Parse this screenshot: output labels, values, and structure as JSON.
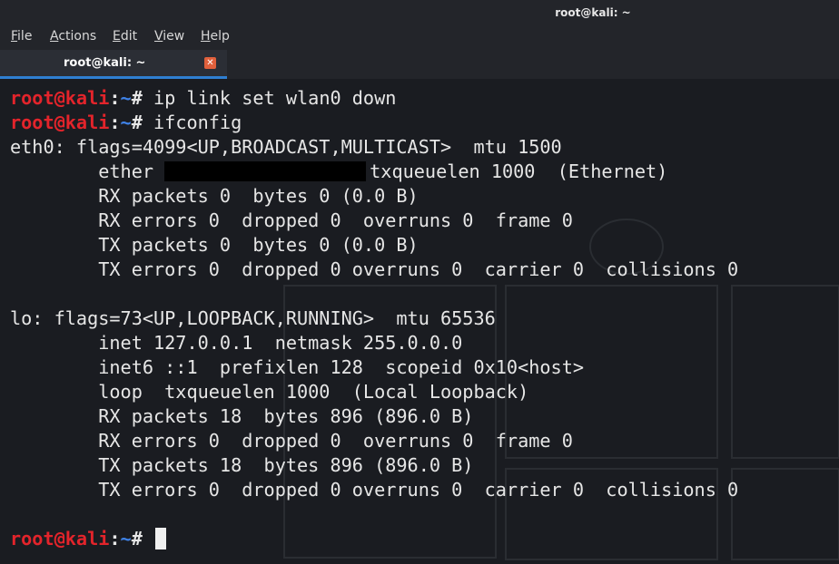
{
  "window": {
    "title": "root@kali: ~"
  },
  "menu": [
    "File",
    "Actions",
    "Edit",
    "View",
    "Help"
  ],
  "tab": {
    "label": "root@kali: ~"
  },
  "prompt": {
    "user": "root@kali",
    "colon": ":",
    "path": "~",
    "symbol": "#"
  },
  "terminal": {
    "cmd1": " ip link set wlan0 down",
    "cmd2": " ifconfig",
    "eth0": {
      "header": "eth0: flags=4099<UP,BROADCAST,MULTICAST>  mtu 1500",
      "ether_prefix": "        ether ",
      "ether_suffix": "txqueuelen 1000  (Ethernet)",
      "rx_packets": "        RX packets 0  bytes 0 (0.0 B)",
      "rx_errors": "        RX errors 0  dropped 0  overruns 0  frame 0",
      "tx_packets": "        TX packets 0  bytes 0 (0.0 B)",
      "tx_errors": "        TX errors 0  dropped 0 overruns 0  carrier 0  collisions 0"
    },
    "lo": {
      "header": "lo: flags=73<UP,LOOPBACK,RUNNING>  mtu 65536",
      "inet": "        inet 127.0.0.1  netmask 255.0.0.0",
      "inet6": "        inet6 ::1  prefixlen 128  scopeid 0x10<host>",
      "loop": "        loop  txqueuelen 1000  (Local Loopback)",
      "rx_packets": "        RX packets 18  bytes 896 (896.0 B)",
      "rx_errors": "        RX errors 0  dropped 0  overruns 0  frame 0",
      "tx_packets": "        TX packets 18  bytes 896 (896.0 B)",
      "tx_errors": "        TX errors 0  dropped 0 overruns 0  carrier 0  collisions 0"
    }
  },
  "colors": {
    "prompt_user": "#e3242b",
    "prompt_path": "#3f83e8",
    "tab_accent": "#2f7fd2",
    "close_button": "#e0603c"
  }
}
